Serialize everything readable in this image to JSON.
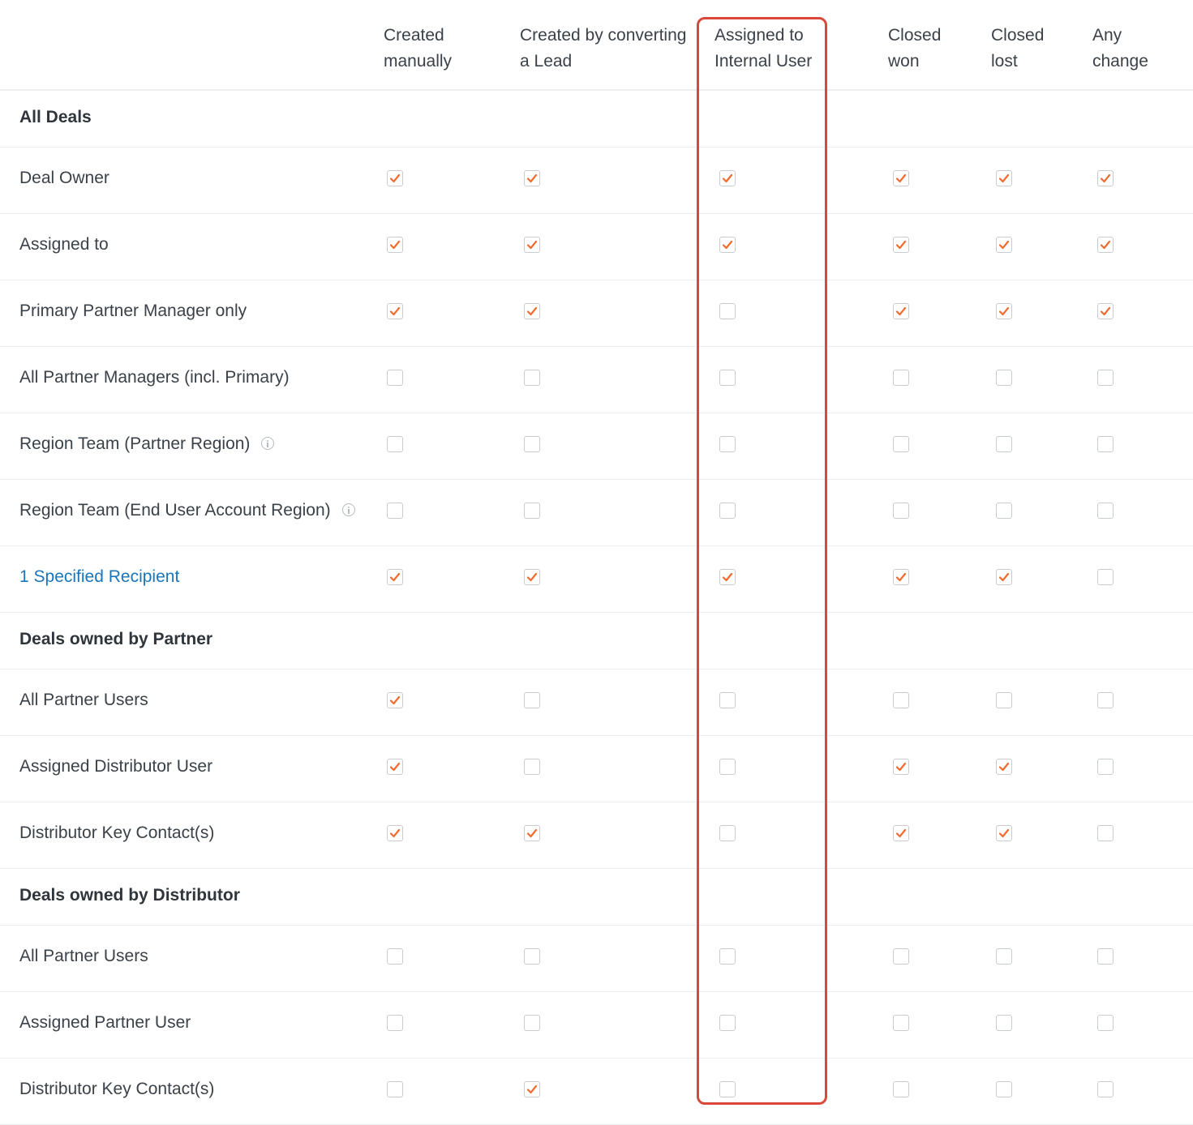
{
  "colors": {
    "accent": "#f26b2e",
    "highlight": "#d9483b",
    "link": "#1b75b9"
  },
  "columns": [
    {
      "key": "created_manually",
      "label": "Created\nmanually"
    },
    {
      "key": "created_by_converting",
      "label": "Created by converting\na Lead"
    },
    {
      "key": "assigned_internal",
      "label": "Assigned to\nInternal User"
    },
    {
      "key": "closed_won",
      "label": "Closed\nwon"
    },
    {
      "key": "closed_lost",
      "label": "Closed\nlost"
    },
    {
      "key": "any_change",
      "label": "Any\nchange"
    }
  ],
  "rows": [
    {
      "type": "section",
      "label": "All Deals"
    },
    {
      "type": "item",
      "label": "Deal Owner",
      "checks": [
        true,
        true,
        true,
        true,
        true,
        true
      ]
    },
    {
      "type": "item",
      "label": "Assigned to",
      "checks": [
        true,
        true,
        true,
        true,
        true,
        true
      ]
    },
    {
      "type": "item",
      "label": "Primary Partner Manager only",
      "checks": [
        true,
        true,
        false,
        true,
        true,
        true
      ]
    },
    {
      "type": "item",
      "label": "All Partner Managers (incl. Primary)",
      "checks": [
        false,
        false,
        false,
        false,
        false,
        false
      ]
    },
    {
      "type": "item",
      "label": "Region Team (Partner Region)",
      "info": "info-icon",
      "checks": [
        false,
        false,
        false,
        false,
        false,
        false
      ]
    },
    {
      "type": "item",
      "label": "Region Team (End User Account Region)",
      "info": "info-icon",
      "checks": [
        false,
        false,
        false,
        false,
        false,
        false
      ]
    },
    {
      "type": "item",
      "label": "1 Specified Recipient",
      "link": true,
      "checks": [
        true,
        true,
        true,
        true,
        true,
        false
      ]
    },
    {
      "type": "section",
      "label": "Deals owned by Partner"
    },
    {
      "type": "item",
      "label": "All Partner Users",
      "checks": [
        true,
        false,
        false,
        false,
        false,
        false
      ]
    },
    {
      "type": "item",
      "label": "Assigned Distributor User",
      "checks": [
        true,
        false,
        false,
        true,
        true,
        false
      ]
    },
    {
      "type": "item",
      "label": "Distributor Key Contact(s)",
      "checks": [
        true,
        true,
        false,
        true,
        true,
        false
      ]
    },
    {
      "type": "section",
      "label": "Deals owned by Distributor"
    },
    {
      "type": "item",
      "label": "All Partner Users",
      "checks": [
        false,
        false,
        false,
        false,
        false,
        false
      ]
    },
    {
      "type": "item",
      "label": "Assigned Partner User",
      "checks": [
        false,
        false,
        false,
        false,
        false,
        false
      ]
    },
    {
      "type": "item",
      "label": "Distributor Key Contact(s)",
      "checks": [
        false,
        true,
        false,
        false,
        false,
        false
      ]
    }
  ]
}
